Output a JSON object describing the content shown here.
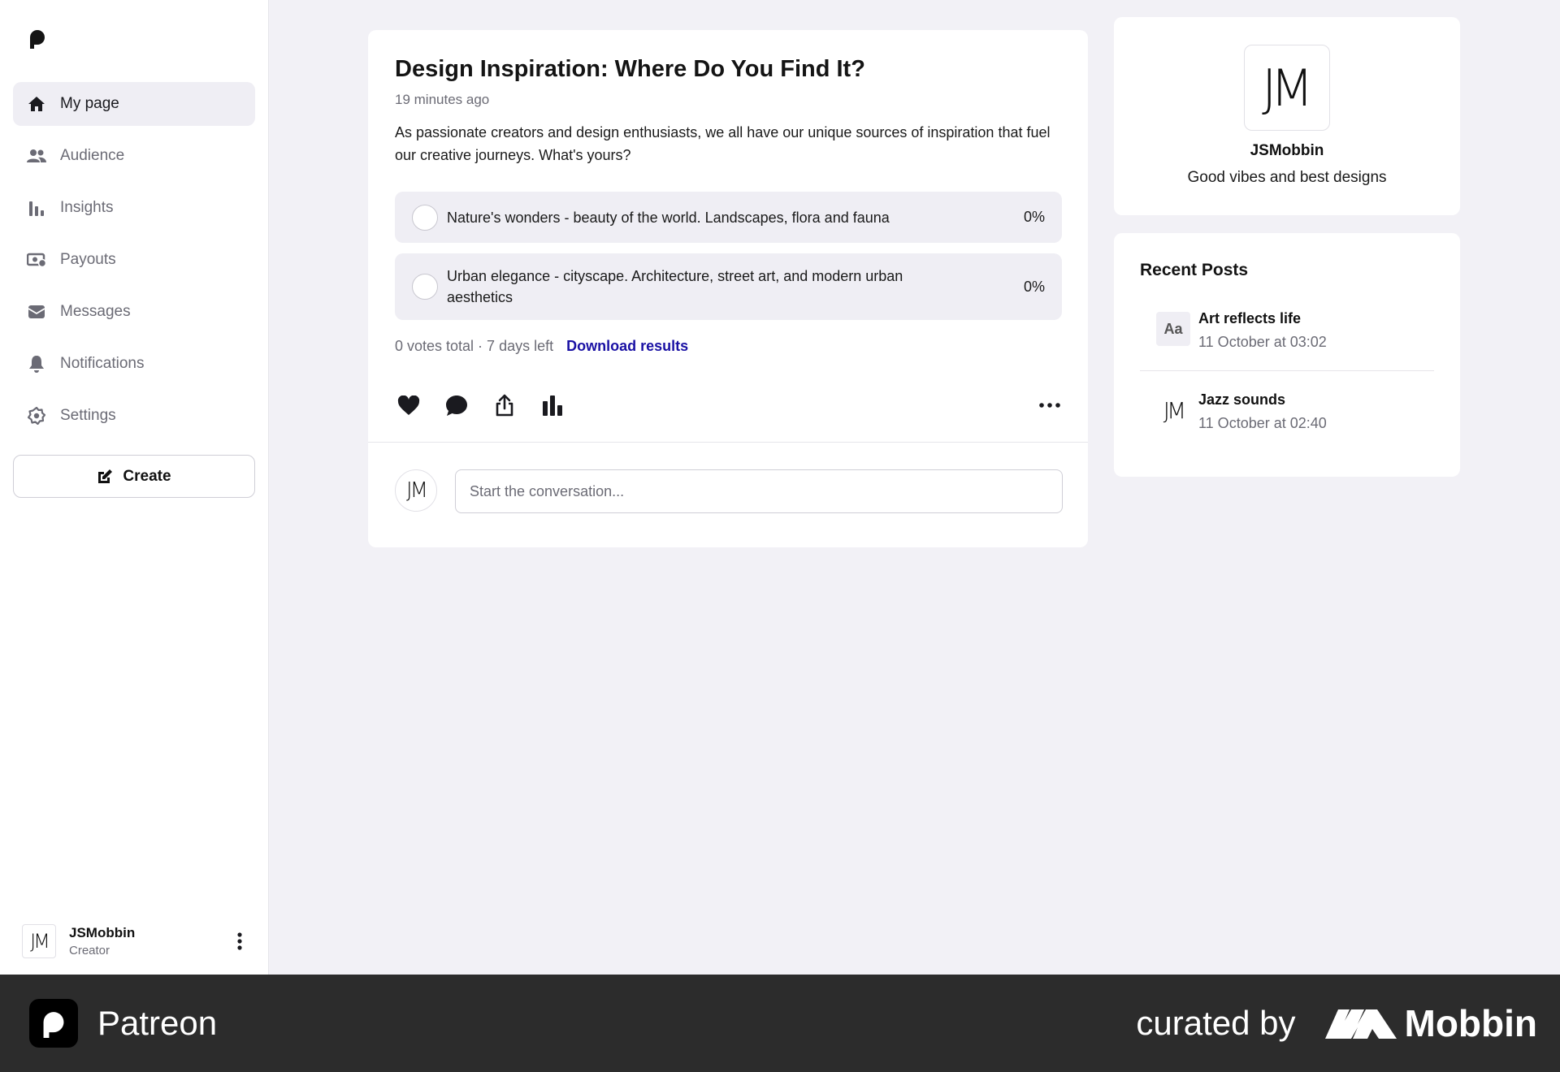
{
  "sidebar": {
    "items": [
      {
        "label": "My page",
        "icon": "home-icon",
        "active": true
      },
      {
        "label": "Audience",
        "icon": "users-icon"
      },
      {
        "label": "Insights",
        "icon": "bar-chart-icon"
      },
      {
        "label": "Payouts",
        "icon": "money-icon"
      },
      {
        "label": "Messages",
        "icon": "envelope-icon"
      },
      {
        "label": "Notifications",
        "icon": "bell-icon"
      },
      {
        "label": "Settings",
        "icon": "gear-icon"
      }
    ],
    "create_label": "Create",
    "profile": {
      "name": "JSMobbin",
      "role": "Creator",
      "avatar_text": "JM"
    }
  },
  "post": {
    "title": "Design Inspiration: Where Do You Find It?",
    "time": "19 minutes ago",
    "body": "As passionate creators and design enthusiasts, we all have our unique sources of inspiration that fuel our creative journeys. What's yours?",
    "options": [
      {
        "text": "Nature's wonders - beauty of the world. Landscapes, flora and fauna",
        "percent": "0%"
      },
      {
        "text": "Urban elegance - cityscape. Architecture, street art, and modern urban aesthetics",
        "percent": "0%"
      }
    ],
    "meta": "0 votes total · 7 days left",
    "download_label": "Download results",
    "comment_placeholder": "Start the conversation...",
    "avatar_text": "JM"
  },
  "creator": {
    "avatar_text": "JM",
    "name": "JSMobbin",
    "tagline": "Good vibes and best designs"
  },
  "recent": {
    "title": "Recent Posts",
    "items": [
      {
        "thumb": "Aa",
        "title": "Art reflects life",
        "date": "11 October at 03:02"
      },
      {
        "thumb": "JM",
        "title": "Jazz sounds",
        "date": "11 October at 02:40"
      }
    ]
  },
  "footer": {
    "app_name": "Patreon",
    "curated": "curated by",
    "mobbin": "Mobbin"
  },
  "colors": {
    "accent_link": "#1a11a4",
    "background": "#f2f1f6",
    "footer": "#2c2c2c"
  }
}
